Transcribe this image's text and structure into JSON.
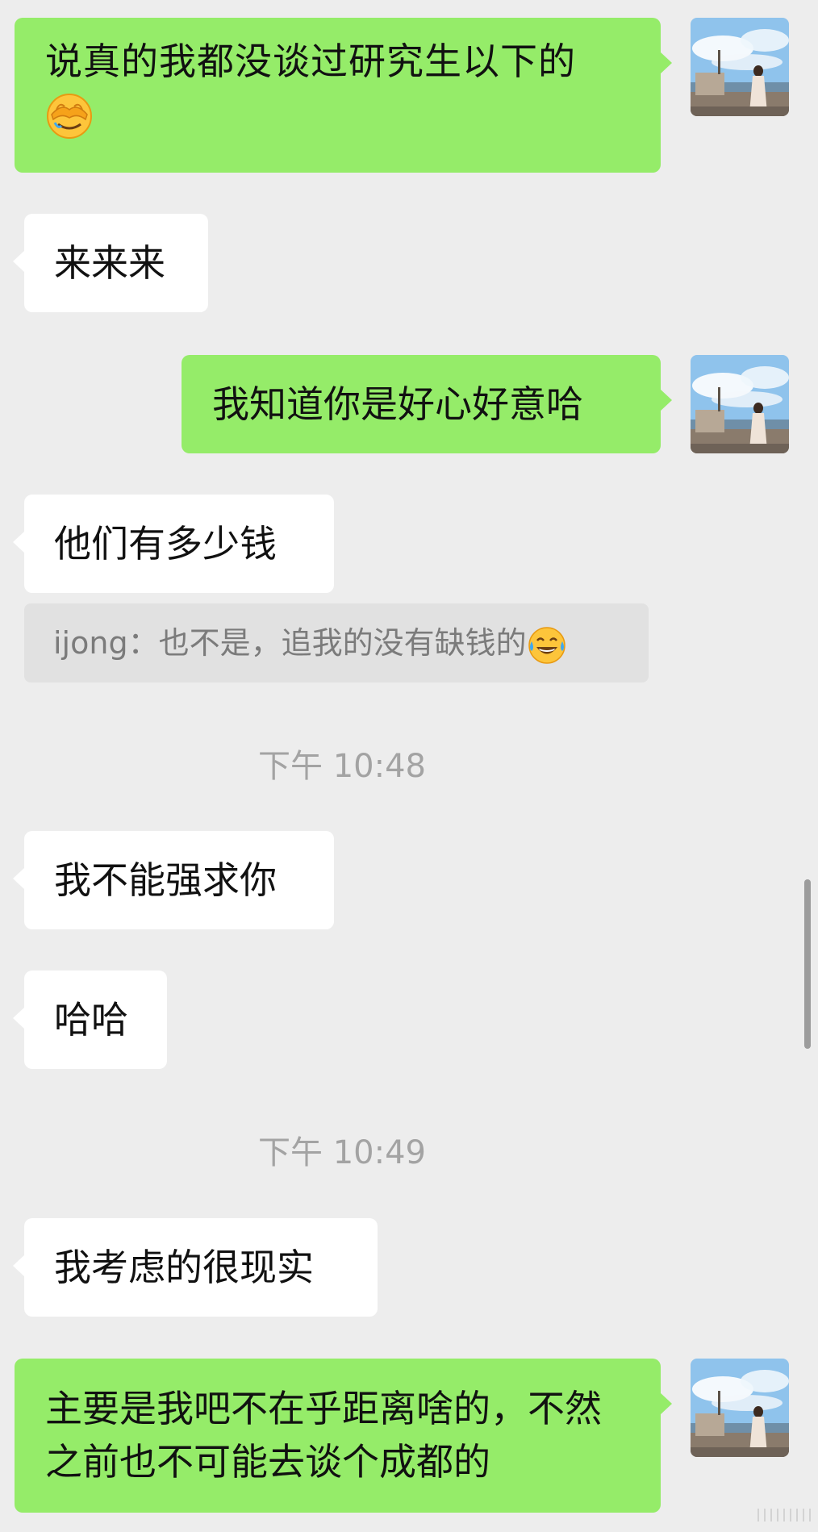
{
  "messages": [
    {
      "side": "out",
      "text": "说真的我都没谈过研究生以下的",
      "emoji": "face-with-hand-over-eyes-emoji"
    },
    {
      "side": "in",
      "text": "来来来"
    },
    {
      "side": "out",
      "text": "我知道你是好心好意哈"
    },
    {
      "side": "in",
      "text": "他们有多少钱"
    },
    {
      "quote": {
        "sender": "ijong",
        "separator": "：",
        "text": "也不是，追我的没有缺钱的",
        "emoji": "tears-of-joy-emoji"
      }
    },
    {
      "timestamp": "下午 10:48"
    },
    {
      "side": "in",
      "text": "我不能强求你"
    },
    {
      "side": "in",
      "text": "哈哈"
    },
    {
      "timestamp": "下午 10:49"
    },
    {
      "side": "in",
      "text": "我考虑的很现实"
    },
    {
      "side": "out",
      "text": "主要是我吧不在乎距离啥的，不然之前也不可能去谈个成都的"
    }
  ],
  "colors": {
    "background": "#ededed",
    "outgoing_bubble": "#95ec69",
    "incoming_bubble": "#ffffff",
    "quote_background": "#e1e1e1",
    "quote_text": "#7b7b7b",
    "timestamp_text": "#a3a3a3"
  },
  "icons": {
    "avatar": "avatar-photo-seaside",
    "emoji_1": "face-with-hand-over-eyes-emoji",
    "emoji_2": "tears-of-joy-emoji"
  }
}
